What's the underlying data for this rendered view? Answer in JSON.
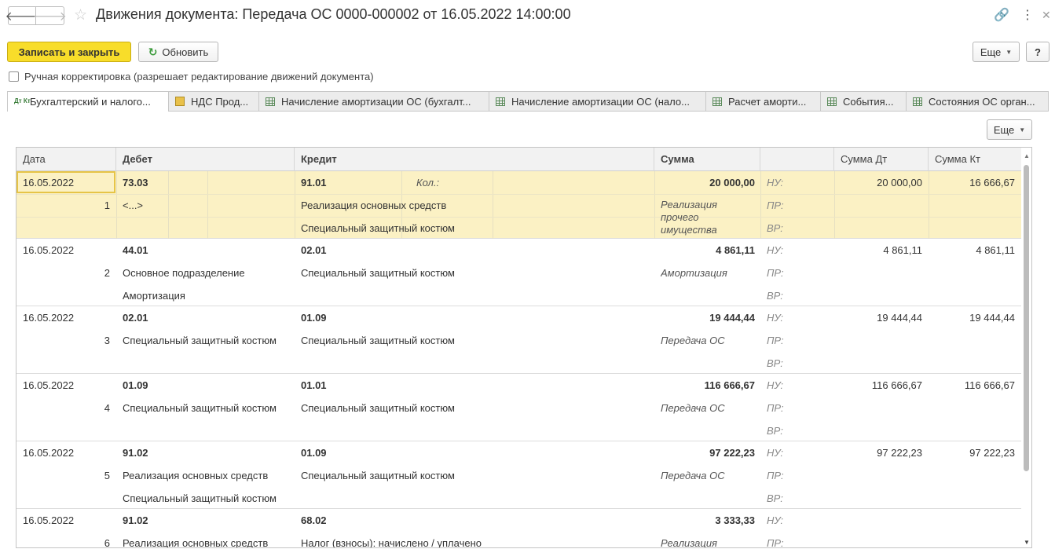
{
  "window": {
    "title": "Движения документа: Передача ОС 0000-000002 от 16.05.2022 14:00:00",
    "back_icon": "🡐",
    "forward_icon": "🡒",
    "star_icon": "☆",
    "link_icon": "🔗",
    "menu_icon": "⋮",
    "close_icon": "✕"
  },
  "toolbar": {
    "save_close": "Записать и закрыть",
    "refresh": "Обновить",
    "refresh_icon": "↻",
    "more": "Еще",
    "help": "?"
  },
  "manual_edit": {
    "label": "Ручная корректировка (разрешает редактирование движений документа)"
  },
  "tabs": [
    {
      "label": "Бухгалтерский и налого...",
      "icon": "Дт Кт"
    },
    {
      "label": "НДС Прод..."
    },
    {
      "label": "Начисление амортизации ОС (бухгалт..."
    },
    {
      "label": "Начисление амортизации ОС (нало..."
    },
    {
      "label": "Расчет аморти..."
    },
    {
      "label": "События..."
    },
    {
      "label": "Состояния ОС орган..."
    }
  ],
  "grid_toolbar": {
    "more": "Еще"
  },
  "grid": {
    "columns": {
      "date": "Дата",
      "debit": "Дебет",
      "credit": "Кредит",
      "sum": "Сумма",
      "sum_dt": "Сумма Дт",
      "sum_kt": "Сумма Кт"
    },
    "rows": [
      {
        "date": "16.05.2022",
        "num": "1",
        "debit_acc": "73.03",
        "debit_sub1": "<...>",
        "debit_sub2": "",
        "credit_acc": "91.01",
        "credit_qty_label": "Кол.:",
        "credit_sub1": "Реализация основных средств",
        "credit_sub2": "Специальный защитный костюм",
        "sum": "20 000,00",
        "content": "Реализация прочего имущества",
        "nu": "НУ:",
        "pr": "ПР:",
        "vr": "ВР:",
        "sum_dt": "20 000,00",
        "sum_kt": "16 666,67"
      },
      {
        "date": "16.05.2022",
        "num": "2",
        "debit_acc": "44.01",
        "debit_sub1": "Основное подразделение",
        "debit_sub2": "Амортизация",
        "credit_acc": "02.01",
        "credit_sub1": "Специальный защитный костюм",
        "credit_sub2": "",
        "sum": "4 861,11",
        "content": "Амортизация",
        "nu": "НУ:",
        "pr": "ПР:",
        "vr": "ВР:",
        "sum_dt": "4 861,11",
        "sum_kt": "4 861,11"
      },
      {
        "date": "16.05.2022",
        "num": "3",
        "debit_acc": "02.01",
        "debit_sub1": "Специальный защитный костюм",
        "debit_sub2": "",
        "credit_acc": "01.09",
        "credit_sub1": "Специальный защитный костюм",
        "credit_sub2": "",
        "sum": "19 444,44",
        "content": "Передача ОС",
        "nu": "НУ:",
        "pr": "ПР:",
        "vr": "ВР:",
        "sum_dt": "19 444,44",
        "sum_kt": "19 444,44"
      },
      {
        "date": "16.05.2022",
        "num": "4",
        "debit_acc": "01.09",
        "debit_sub1": "Специальный защитный костюм",
        "debit_sub2": "",
        "credit_acc": "01.01",
        "credit_sub1": "Специальный защитный костюм",
        "credit_sub2": "",
        "sum": "116 666,67",
        "content": "Передача ОС",
        "nu": "НУ:",
        "pr": "ПР:",
        "vr": "ВР:",
        "sum_dt": "116 666,67",
        "sum_kt": "116 666,67"
      },
      {
        "date": "16.05.2022",
        "num": "5",
        "debit_acc": "91.02",
        "debit_sub1": "Реализация основных средств",
        "debit_sub2": "Специальный защитный костюм",
        "credit_acc": "01.09",
        "credit_sub1": "Специальный защитный костюм",
        "credit_sub2": "",
        "sum": "97 222,23",
        "content": "Передача ОС",
        "nu": "НУ:",
        "pr": "ПР:",
        "vr": "ВР:",
        "sum_dt": "97 222,23",
        "sum_kt": "97 222,23"
      },
      {
        "date": "16.05.2022",
        "num": "6",
        "debit_acc": "91.02",
        "debit_sub1": "Реализация основных средств",
        "debit_sub2": "",
        "credit_acc": "68.02",
        "credit_sub1": "Налог (взносы): начислено / уплачено",
        "credit_sub2": "",
        "sum": "3 333,33",
        "content": "Реализация",
        "nu": "НУ:",
        "pr": "ПР:",
        "vr": "",
        "sum_dt": "",
        "sum_kt": ""
      }
    ]
  }
}
